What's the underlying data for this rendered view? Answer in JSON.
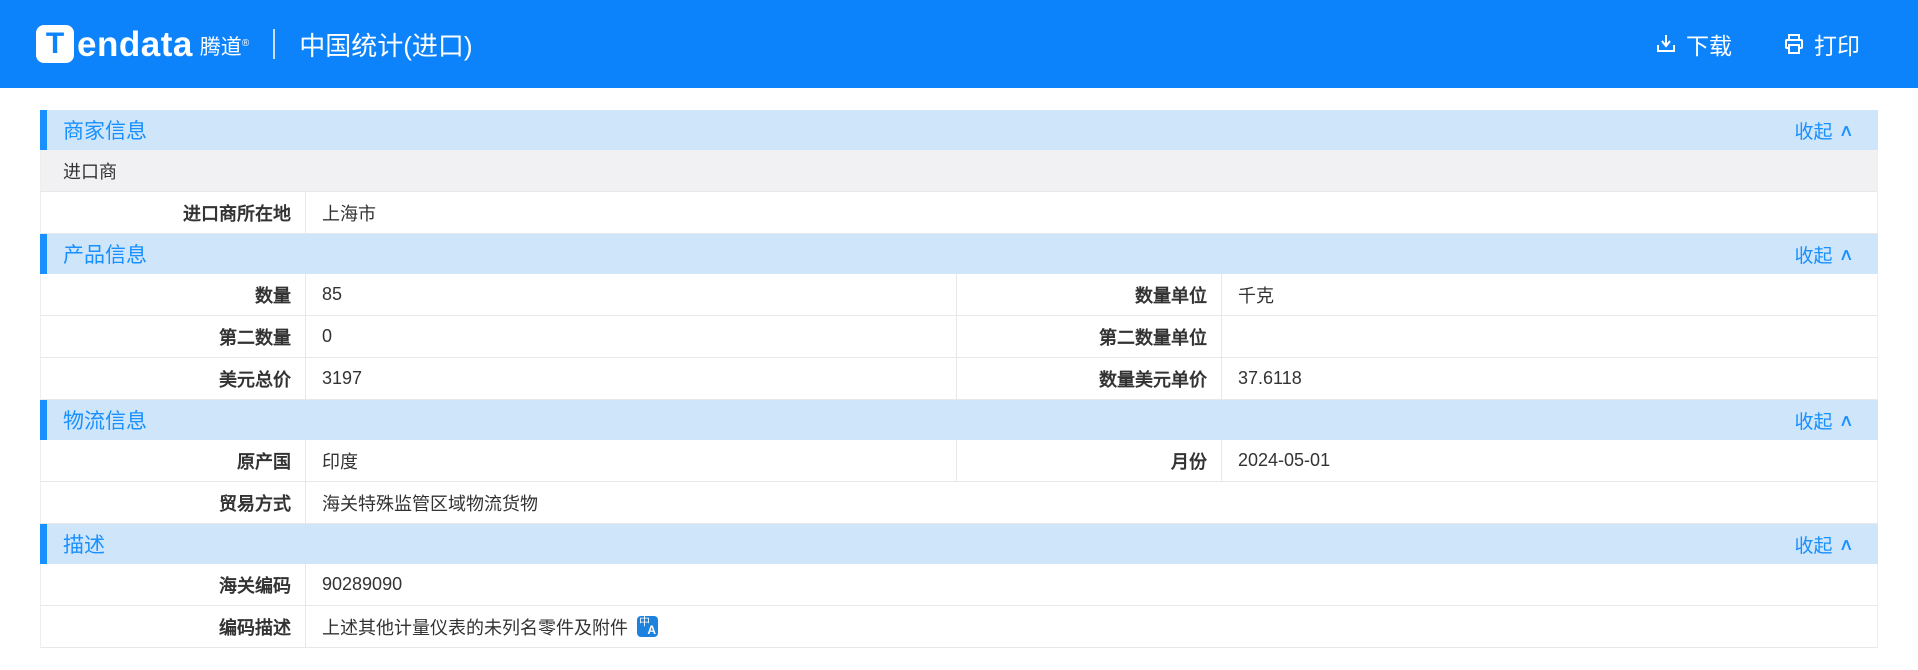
{
  "theme": {
    "topbar_blue": "#0d83fb",
    "accent_blue": "#1890ff",
    "section_header_bg": "#cfe6fa",
    "subheader_row_bg": "#f1f1f4",
    "border": "#e8e8e8",
    "text": "#333333"
  },
  "topbar": {
    "logo_glyph": "T",
    "logo_text": "endata",
    "logo_cn": "腾道",
    "logo_reg": "®",
    "title": "中国统计(进口)",
    "download_label": "下载",
    "print_label": "打印"
  },
  "ui": {
    "collapse_label": "收起",
    "collapse_chevron": "∧",
    "translate_zh": "中",
    "translate_a": "A"
  },
  "sections": [
    {
      "title": "商家信息",
      "rows": [
        {
          "type": "subheader",
          "label": "进口商"
        },
        {
          "type": "single",
          "label": "进口商所在地",
          "value": "上海市"
        }
      ]
    },
    {
      "title": "产品信息",
      "rows": [
        {
          "type": "double",
          "label1": "数量",
          "value1": "85",
          "label2": "数量单位",
          "value2": "千克"
        },
        {
          "type": "double",
          "label1": "第二数量",
          "value1": "0",
          "label2": "第二数量单位",
          "value2": ""
        },
        {
          "type": "double",
          "label1": "美元总价",
          "value1": "3197",
          "label2": "数量美元单价",
          "value2": "37.6118"
        }
      ]
    },
    {
      "title": "物流信息",
      "rows": [
        {
          "type": "double",
          "label1": "原产国",
          "value1": "印度",
          "label2": "月份",
          "value2": "2024-05-01"
        },
        {
          "type": "single",
          "label": "贸易方式",
          "value": "海关特殊监管区域物流货物"
        }
      ]
    },
    {
      "title": "描述",
      "rows": [
        {
          "type": "single",
          "label": "海关编码",
          "value": "90289090"
        },
        {
          "type": "single",
          "label": "编码描述",
          "value": "上述其他计量仪表的未列名零件及附件",
          "icon": "translate-icon"
        }
      ]
    }
  ]
}
